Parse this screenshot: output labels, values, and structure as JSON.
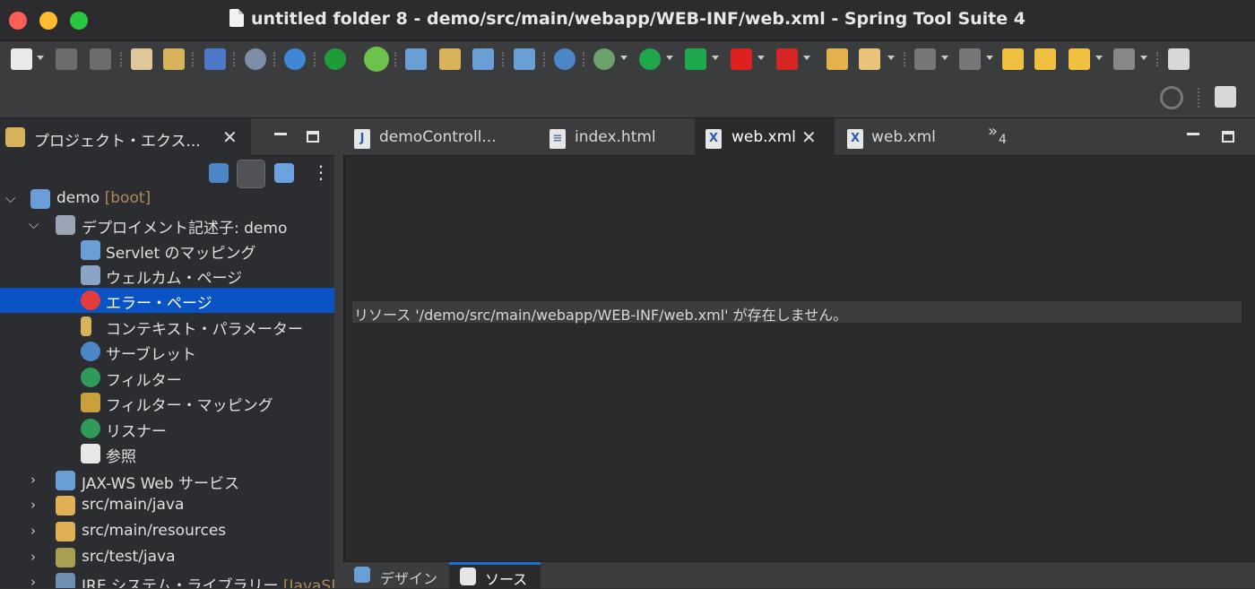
{
  "window": {
    "title": "untitled folder 8 - demo/src/main/webapp/WEB-INF/web.xml - Spring Tool Suite 4"
  },
  "toolbar": {
    "icons": [
      "new-icon",
      "save-icon",
      "save-all-icon",
      "publish-icon",
      "export-icon",
      "terminal-icon",
      "search-declarations-icon",
      "gear-icon",
      "power-icon",
      "spring-leaf-icon",
      "new-package-icon",
      "new-class-icon",
      "new-file-icon",
      "run-on-server-icon",
      "globe-icon",
      "debug-icon",
      "run-icon",
      "run-external-icon",
      "stop-icon",
      "flag-icon",
      "open-folder-icon",
      "marker-icon",
      "next-annotation-icon",
      "prev-annotation-icon",
      "back-to-last-icon",
      "forward-to-last-icon",
      "back-icon",
      "forward-icon",
      "open-perspective-icon"
    ]
  },
  "left_panel": {
    "tab_label": "プロジェクト・エクス...",
    "tree": [
      {
        "label": "demo",
        "suffix": "[boot]",
        "depth": 0,
        "expanded": true,
        "icon": "project-icon"
      },
      {
        "label": "デプロイメント記述子: demo",
        "depth": 1,
        "expanded": true,
        "icon": "deployment-descriptor-icon"
      },
      {
        "label": "Servlet のマッピング",
        "depth": 2,
        "icon": "servlet-mapping-icon"
      },
      {
        "label": "ウェルカム・ページ",
        "depth": 2,
        "icon": "welcome-page-icon"
      },
      {
        "label": "エラー・ページ",
        "depth": 2,
        "icon": "error-page-icon",
        "selected": true
      },
      {
        "label": "コンテキスト・パラメーター",
        "depth": 2,
        "icon": "context-param-icon"
      },
      {
        "label": "サーブレット",
        "depth": 2,
        "icon": "servlet-icon"
      },
      {
        "label": "フィルター",
        "depth": 2,
        "icon": "filter-icon"
      },
      {
        "label": "フィルター・マッピング",
        "depth": 2,
        "icon": "filter-mapping-icon"
      },
      {
        "label": "リスナー",
        "depth": 2,
        "icon": "listener-icon"
      },
      {
        "label": "参照",
        "depth": 2,
        "icon": "reference-icon"
      },
      {
        "label": "JAX-WS Web サービス",
        "depth": 1,
        "collapsed": true,
        "icon": "web-service-icon"
      },
      {
        "label": "src/main/java",
        "depth": 1,
        "collapsed": true,
        "icon": "source-folder-icon"
      },
      {
        "label": "src/main/resources",
        "depth": 1,
        "collapsed": true,
        "icon": "source-folder-icon"
      },
      {
        "label": "src/test/java",
        "depth": 1,
        "collapsed": true,
        "icon": "test-folder-icon"
      },
      {
        "label": "JRE システム・ライブラリー",
        "suffix": "[JavaSE",
        "depth": 1,
        "collapsed": true,
        "icon": "library-icon"
      }
    ]
  },
  "editor": {
    "tabs": [
      {
        "label": "demoControll...",
        "icon_char": "J"
      },
      {
        "label": "index.html",
        "icon_char": "≡"
      },
      {
        "label": "web.xml",
        "icon_char": "X",
        "active": true
      },
      {
        "label": "web.xml",
        "icon_char": "X"
      }
    ],
    "overflow": "»",
    "overflow_count": "4",
    "message": "リソース '/demo/src/main/webapp/WEB-INF/web.xml' が存在しません。",
    "bottom_tabs": [
      {
        "label": "デザイン"
      },
      {
        "label": "ソース",
        "active": true
      }
    ]
  },
  "colors": {
    "selection": "#0a53c4",
    "editor_bg": "#2b2b2b",
    "boot_suffix": "#b08a55"
  }
}
